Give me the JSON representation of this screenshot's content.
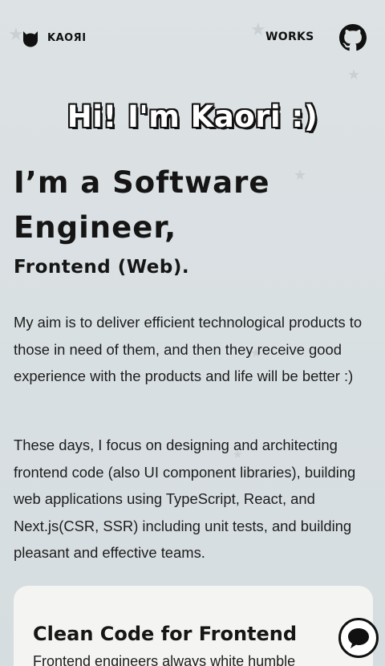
{
  "header": {
    "brand_name": "KAOЯI",
    "nav_works": "WORKS"
  },
  "hero": {
    "greeting": "Hi! I'm Kaori :)",
    "title": "I’m a Software Engineer,",
    "subtitle": "Frontend (Web).",
    "paragraph_1": "My aim is to deliver efficient technological products to those in need of them, and then they receive good experience with the products and life will be better :)",
    "paragraph_2": "These days, I focus on designing and architecting frontend code (also UI component libraries), building web applications using TypeScript, React, and Next.js(CSR, SSR) including unit tests, and building pleasant and effective teams."
  },
  "card": {
    "title": "Clean Code for Frontend",
    "description": "Frontend engineers always white humble"
  },
  "icons": {
    "brand": "cat-face-icon",
    "github": "github-icon",
    "chat": "chat-bubble-icon",
    "background": "star-icon"
  },
  "colors": {
    "background": "#dde2e4",
    "text": "#141414",
    "card": "#f4f4f2"
  }
}
